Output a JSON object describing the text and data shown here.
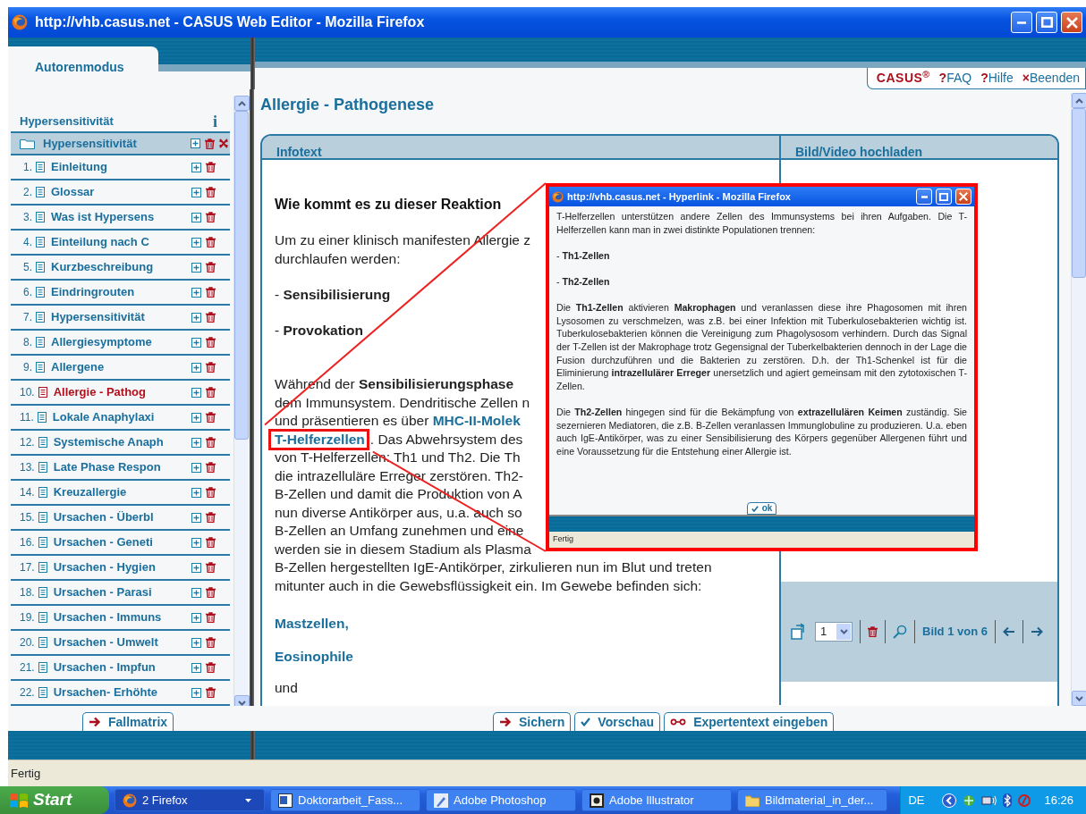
{
  "window": {
    "title": "http://vhb.casus.net - CASUS Web Editor - Mozilla Firefox"
  },
  "mode_tab": {
    "label": "Autorenmodus",
    "selected": true
  },
  "header_links": [
    {
      "kind": "logo",
      "label": "CASUS$^{®}$"
    },
    {
      "kind": "link",
      "icon": "?",
      "label": "FAQ"
    },
    {
      "kind": "link",
      "icon": "?",
      "label": "Hilfe"
    },
    {
      "kind": "link",
      "icon": "×",
      "label": "Beenden"
    }
  ],
  "sidebar": {
    "title": "Hypersensitivität",
    "info": "i",
    "root": {
      "label": "Hypersensitivität"
    },
    "items": [
      {
        "number": "1.",
        "label": "Einleitung",
        "selected": false
      },
      {
        "number": "2.",
        "label": "Glossar",
        "selected": false
      },
      {
        "number": "3.",
        "label": "Was ist Hypersens",
        "selected": false
      },
      {
        "number": "4.",
        "label": "Einteilung nach C",
        "selected": false
      },
      {
        "number": "5.",
        "label": "Kurzbeschreibung",
        "selected": false
      },
      {
        "number": "6.",
        "label": "Eindringrouten",
        "selected": false
      },
      {
        "number": "7.",
        "label": "Hypersensitivität",
        "selected": false
      },
      {
        "number": "8.",
        "label": "Allergiesymptome",
        "selected": false
      },
      {
        "number": "9.",
        "label": "Allergene",
        "selected": false
      },
      {
        "number": "10.",
        "label": "Allergie - Pathog",
        "selected": true
      },
      {
        "number": "11.",
        "label": "Lokale Anaphylaxi",
        "selected": false
      },
      {
        "number": "12.",
        "label": "Systemische Anaph",
        "selected": false
      },
      {
        "number": "13.",
        "label": "Late Phase Respon",
        "selected": false
      },
      {
        "number": "14.",
        "label": "Kreuzallergie",
        "selected": false
      },
      {
        "number": "15.",
        "label": "Ursachen - Überbl",
        "selected": false
      },
      {
        "number": "16.",
        "label": "Ursachen - Geneti",
        "selected": false
      },
      {
        "number": "17.",
        "label": "Ursachen - Hygien",
        "selected": false
      },
      {
        "number": "18.",
        "label": "Ursachen - Parasi",
        "selected": false
      },
      {
        "number": "19.",
        "label": "Ursachen - Immuns",
        "selected": false
      },
      {
        "number": "20.",
        "label": "Ursachen - Umwelt",
        "selected": false
      },
      {
        "number": "21.",
        "label": "Ursachen - Impfun",
        "selected": false
      },
      {
        "number": "22.",
        "label": "Ursachen- Erhöhte",
        "selected": false
      }
    ]
  },
  "page_title": "Allergie - Pathogenese",
  "infotext": {
    "tab": "Infotext",
    "blocks": [
      {
        "kind": "heading",
        "text": "Wie kommt es zu dieser Reaktion"
      },
      {
        "kind": "lines",
        "lines": [
          [
            {
              "text": "Um zu einer klinisch manifesten Allergie z"
            }
          ],
          [
            {
              "text": "durchlaufen werden:"
            }
          ]
        ]
      },
      {
        "kind": "lines",
        "lines": [
          [
            {
              "text": "- **Sensibilisierung**"
            }
          ]
        ]
      },
      {
        "kind": "lines",
        "lines": [
          [
            {
              "text": "- **Provokation**"
            }
          ]
        ]
      },
      {
        "kind": "lines",
        "lines": [
          [
            {
              "text": "Während der **Sensibilisierungsphase**"
            }
          ],
          [
            {
              "text": "dem Immunsystem. Dendritische Zellen n"
            }
          ],
          [
            {
              "text": "und präsentieren es über "
            },
            {
              "text": "MHC-II-Molek",
              "kind": "link"
            }
          ],
          [
            {
              "text": "T-Helferzellen",
              "kind": "link",
              "highlighted": true
            },
            {
              "text": ". Das Abwehrsystem des"
            }
          ],
          [
            {
              "text": "von T-Helferzellen: Th1 und Th2. Die Th"
            }
          ],
          [
            {
              "text": "die intrazelluläre Erreger zerstören. Th2-"
            }
          ],
          [
            {
              "text": "B-Zellen und damit die Produktion von A"
            }
          ],
          [
            {
              "text": "nun diverse Antikörper aus, u.a. auch so"
            }
          ],
          [
            {
              "text": "B-Zellen an Umfang zunehmen und eine"
            }
          ],
          [
            {
              "text": "werden sie in diesem Stadium als Plasma"
            }
          ],
          [
            {
              "text": "B-Zellen hergestellten IgE-Antikörper, zirkulieren nun im Blut und treten"
            }
          ],
          [
            {
              "text": "mitunter auch in die Gewebsflüssigkeit ein. Im Gewebe befinden sich:"
            }
          ]
        ]
      },
      {
        "kind": "link",
        "text": "Mastzellen,"
      },
      {
        "kind": "link",
        "text": "Eosinophile"
      },
      {
        "kind": "lines",
        "lines": [
          [
            {
              "text": "und"
            }
          ]
        ]
      }
    ]
  },
  "media": {
    "tab": "Bild/Video hochladen",
    "page_select": "1",
    "counter": "Bild 1 von 6"
  },
  "footer": {
    "sidebar_buttons": [
      {
        "kind": "arrow",
        "label": "Fallmatrix"
      }
    ],
    "editor_buttons": [
      {
        "kind": "arrow",
        "label": "Sichern"
      },
      {
        "kind": "check",
        "label": "Vorschau"
      },
      {
        "kind": "chain",
        "label": "Expertentext eingeben"
      }
    ]
  },
  "status_bar": "Fertig",
  "popup": {
    "title": "http://vhb.casus.net - Hyperlink - Mozilla Firefox",
    "paragraphs": [
      "T-Helferzellen unterstützen andere Zellen des Immunsystems bei ihren Aufgaben. Die T-Helferzellen kann man in zwei distinkte Populationen trennen:",
      "- **Th1-Zellen**",
      "- **Th2-Zellen**",
      "Die **Th1-Zellen** aktivieren **Makrophagen** und veranlassen diese ihre Phagosomen mit ihren Lysosomen zu verschmelzen, was z.B. bei einer Infektion mit Tuberkulosebakterien wichtig ist. Tuberkulosebakterien können die Vereinigung zum Phagolysosom verhindern. Durch das Signal der T-Zellen ist der Makrophage trotz Gegensignal der Tuberkelbakterien dennoch in der Lage die Fusion durchzuführen und die Bakterien zu zerstören. D.h. der Th1-Schenkel ist für die Eliminierung **intrazellulärer Erreger** unersetzlich und agiert gemeinsam mit den zytotoxischen T-Zellen.",
      "Die **Th2-Zellen** hingegen sind für die Bekämpfung von **extrazellulären Keimen** zuständig. Sie sezernieren Mediatoren, die z.B. B-Zellen veranlassen Immunglobuline zu produzieren. U.a. eben auch IgE-Antikörper, was zu einer Sensibilisierung des Körpers gegenüber Allergenen führt und eine Voraussetzung für die Entstehung einer Allergie ist."
    ],
    "ok": "ok",
    "status": "Fertig"
  },
  "taskbar": {
    "start": "Start",
    "items": [
      {
        "kind": "firefox",
        "label": "2 Firefox",
        "selected": true
      },
      {
        "kind": "word",
        "label": "Doktorarbeit_Fass...",
        "selected": false
      },
      {
        "kind": "photoshop",
        "label": "Adobe Photoshop",
        "selected": false
      },
      {
        "kind": "illustrator",
        "label": "Adobe Illustrator",
        "selected": false
      },
      {
        "kind": "folder",
        "label": "Bildmaterial_in_der...",
        "selected": false
      }
    ],
    "language": "DE",
    "clock": "16:26"
  }
}
